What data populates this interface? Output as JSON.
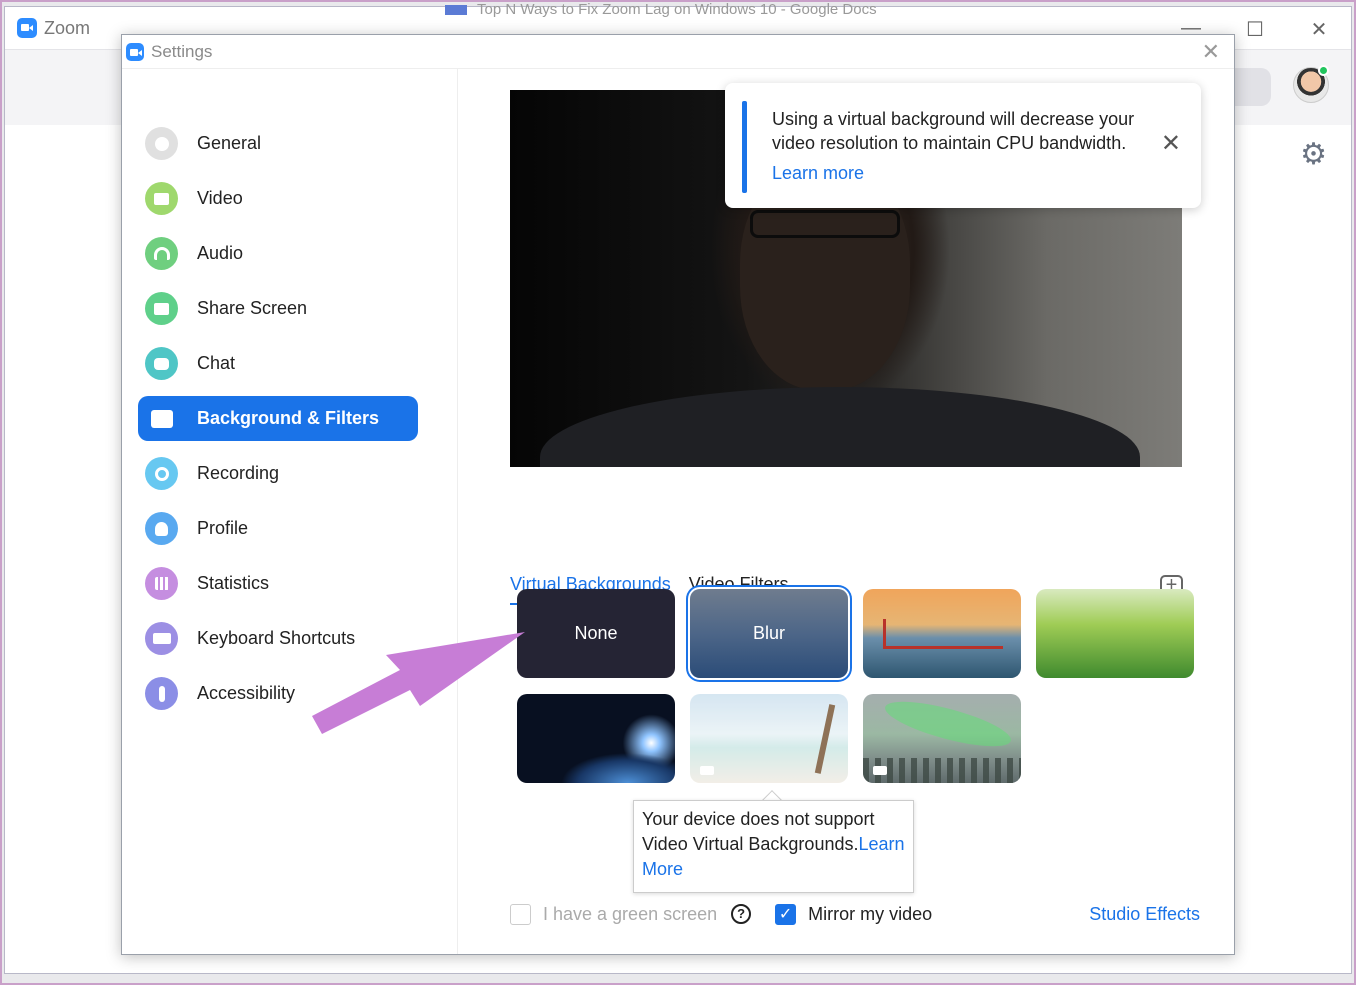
{
  "zoom": {
    "title": "Zoom",
    "doc_tab": "Top N Ways to Fix Zoom Lag on Windows 10 - Google Docs",
    "minimize": "—",
    "maximize": "☐",
    "close": "✕"
  },
  "settings": {
    "title": "Settings",
    "close": "✕",
    "nav": [
      {
        "label": "General",
        "color": "#e0e0e0"
      },
      {
        "label": "Video",
        "color": "#9fd86d"
      },
      {
        "label": "Audio",
        "color": "#6fcf7f"
      },
      {
        "label": "Share Screen",
        "color": "#5fd08a"
      },
      {
        "label": "Chat",
        "color": "#4fc6c6"
      },
      {
        "label": "Background & Filters",
        "color": "#1a73e8"
      },
      {
        "label": "Recording",
        "color": "#67c8f1"
      },
      {
        "label": "Profile",
        "color": "#59a9f0"
      },
      {
        "label": "Statistics",
        "color": "#c58ee0"
      },
      {
        "label": "Keyboard Shortcuts",
        "color": "#9c8fe4"
      },
      {
        "label": "Accessibility",
        "color": "#8b8ee6"
      }
    ],
    "notice": {
      "message": "Using a virtual background will decrease your video resolution to maintain CPU bandwidth.",
      "learn_more": "Learn more",
      "close": "✕"
    },
    "tabs": {
      "virtual": "Virtual Backgrounds",
      "filters": "Video Filters",
      "add": "+"
    },
    "thumbnails": {
      "none": "None",
      "blur": "Blur"
    },
    "unsupported_tip": {
      "text": "Your device does not support Video Virtual Backgrounds.",
      "link1": "Learn",
      "link2": "More"
    },
    "footer": {
      "green_screen": "I have a green screen",
      "help": "?",
      "mirror": "Mirror my video",
      "mirror_checked": true,
      "studio_effects": "Studio Effects"
    }
  },
  "annotation": {
    "arrow_color": "#c77dd6"
  }
}
